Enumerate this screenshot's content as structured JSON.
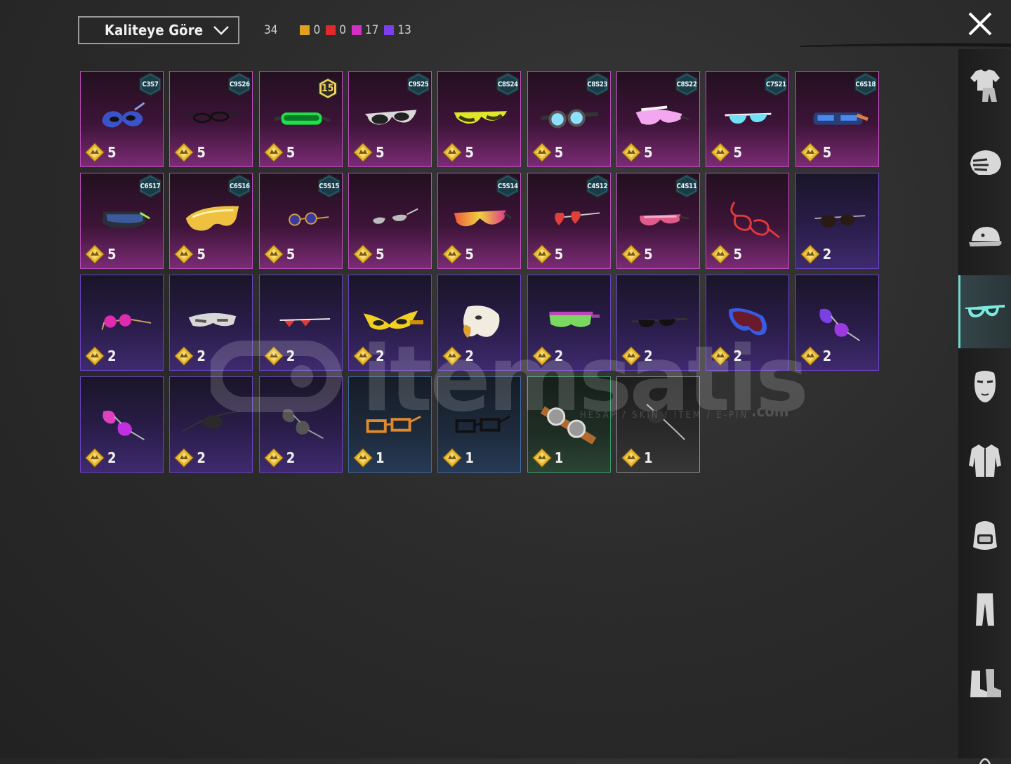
{
  "sort": {
    "label": "Kaliteye Göre"
  },
  "counts": {
    "total": "34",
    "qualities": [
      {
        "color": "#e0a020",
        "count": "0"
      },
      {
        "color": "#e02a2a",
        "count": "0"
      },
      {
        "color": "#d42fc4",
        "count": "17"
      },
      {
        "color": "#7b3ff0",
        "count": "13"
      }
    ]
  },
  "sidebar": {
    "tabs": [
      {
        "icon": "outfit-icon",
        "active": false
      },
      {
        "icon": "helmet-mask-icon",
        "active": false
      },
      {
        "icon": "cap-icon",
        "active": false
      },
      {
        "icon": "glasses-icon",
        "active": true
      },
      {
        "icon": "face-mask-icon",
        "active": false
      },
      {
        "icon": "jacket-icon",
        "active": false
      },
      {
        "icon": "backpack-icon",
        "active": false
      },
      {
        "icon": "pants-icon",
        "active": false
      },
      {
        "icon": "boots-icon",
        "active": false
      }
    ]
  },
  "items": [
    {
      "quality": "pink",
      "badge": "C3S7",
      "value": "5",
      "icon": "masquerade-mask-icon"
    },
    {
      "quality": "pink",
      "badge": "C9S26",
      "value": "5",
      "icon": "thin-glasses-icon"
    },
    {
      "quality": "pink",
      "level": "15",
      "value": "5",
      "icon": "green-goggles-icon"
    },
    {
      "quality": "pink",
      "badge": "C9S25",
      "value": "5",
      "icon": "sport-sunglasses-icon"
    },
    {
      "quality": "pink",
      "badge": "C8S24",
      "value": "5",
      "icon": "yellow-visor-glasses-icon"
    },
    {
      "quality": "pink",
      "badge": "C8S23",
      "value": "5",
      "icon": "aviator-goggles-icon"
    },
    {
      "quality": "pink",
      "badge": "C8S22",
      "value": "5",
      "icon": "pink-shield-glasses-icon"
    },
    {
      "quality": "pink",
      "badge": "C7S21",
      "value": "5",
      "icon": "cyan-shades-icon"
    },
    {
      "quality": "pink",
      "badge": "C6S18",
      "value": "5",
      "icon": "tech-visor-icon"
    },
    {
      "quality": "pink",
      "badge": "C6S17",
      "value": "5",
      "icon": "cyber-visor-icon"
    },
    {
      "quality": "pink",
      "badge": "C6S16",
      "value": "5",
      "icon": "gold-visor-icon"
    },
    {
      "quality": "pink",
      "badge": "C5S15",
      "value": "5",
      "icon": "round-glasses-icon"
    },
    {
      "quality": "pink",
      "value": "5",
      "icon": "cat-eye-glasses-icon"
    },
    {
      "quality": "pink",
      "badge": "C5S14",
      "value": "5",
      "icon": "rainbow-shield-glasses-icon"
    },
    {
      "quality": "pink",
      "badge": "C4S12",
      "value": "5",
      "icon": "heart-glasses-icon"
    },
    {
      "quality": "pink",
      "badge": "C4S11",
      "value": "5",
      "icon": "neon-shades-icon"
    },
    {
      "quality": "pink",
      "value": "5",
      "icon": "red-frame-glasses-icon"
    },
    {
      "quality": "purple",
      "value": "2",
      "icon": "dark-round-glasses-icon"
    },
    {
      "quality": "purple",
      "value": "2",
      "icon": "pink-round-glasses-icon"
    },
    {
      "quality": "purple",
      "value": "2",
      "icon": "silver-visor-icon"
    },
    {
      "quality": "purple",
      "value": "2",
      "icon": "red-heart-shades-icon"
    },
    {
      "quality": "purple",
      "value": "2",
      "icon": "yellow-mask-icon"
    },
    {
      "quality": "purple",
      "value": "2",
      "icon": "eagle-mask-icon"
    },
    {
      "quality": "purple",
      "value": "2",
      "icon": "green-ski-goggles-icon"
    },
    {
      "quality": "purple",
      "value": "2",
      "icon": "black-sunglasses-icon"
    },
    {
      "quality": "purple",
      "value": "2",
      "icon": "blue-ski-goggles-icon"
    },
    {
      "quality": "purple",
      "value": "2",
      "icon": "purple-aviators-icon"
    },
    {
      "quality": "purple",
      "value": "2",
      "icon": "pink-aviators-icon"
    },
    {
      "quality": "purple",
      "value": "2",
      "icon": "eye-patch-icon"
    },
    {
      "quality": "purple",
      "value": "2",
      "icon": "grey-aviators-icon"
    },
    {
      "quality": "blue",
      "value": "1",
      "icon": "orange-rect-glasses-icon"
    },
    {
      "quality": "blue",
      "value": "1",
      "icon": "black-rect-glasses-icon"
    },
    {
      "quality": "green",
      "value": "1",
      "icon": "leather-goggles-icon"
    },
    {
      "quality": "grey",
      "value": "1",
      "icon": "grey-eye-patch-icon"
    }
  ],
  "watermark": {
    "brand": "itemsatis",
    "tagline": "HESAP / SKIN / ITEM / E-PIN",
    "domain": ".com"
  }
}
